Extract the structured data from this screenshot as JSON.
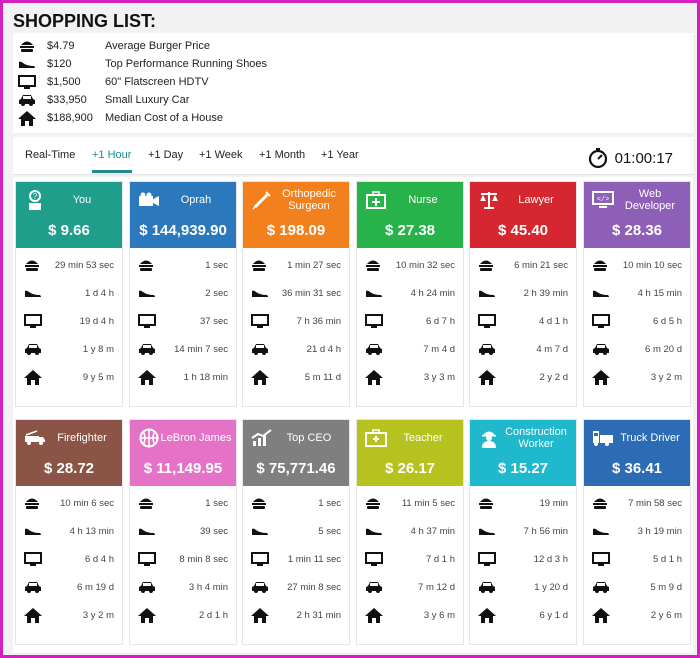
{
  "shopping": {
    "title": "SHOPPING LIST:",
    "items": [
      {
        "icon": "burger-icon",
        "price": "$4.79",
        "name": "Average Burger Price"
      },
      {
        "icon": "shoe-icon",
        "price": "$120",
        "name": "Top Performance Running Shoes"
      },
      {
        "icon": "tv-icon",
        "price": "$1,500",
        "name": "60\" Flatscreen HDTV"
      },
      {
        "icon": "car-icon",
        "price": "$33,950",
        "name": "Small Luxury Car"
      },
      {
        "icon": "house-icon",
        "price": "$188,900",
        "name": "Median Cost of a House"
      }
    ]
  },
  "tabs": [
    "Real-Time",
    "+1 Hour",
    "+1 Day",
    "+1 Week",
    "+1 Month",
    "+1 Year"
  ],
  "active_tab": "+1 Hour",
  "timer": "01:00:17",
  "cards": [
    {
      "name": "You",
      "value": "$ 9.66",
      "color": "#1f9e8c",
      "icon": "person-icon",
      "times": [
        "29 min 53 sec",
        "1 d 4 h",
        "19 d 4 h",
        "1 y 8 m",
        "9 y 5 m"
      ]
    },
    {
      "name": "Oprah",
      "value": "$ 144,939.90",
      "color": "#2b78bd",
      "icon": "camera-icon",
      "times": [
        "1 sec",
        "2 sec",
        "37 sec",
        "14 min 7 sec",
        "1 h 18 min"
      ]
    },
    {
      "name": "Orthopedic Surgeon",
      "value": "$ 198.09",
      "color": "#f2811d",
      "icon": "syringe-icon",
      "times": [
        "1 min 27 sec",
        "36 min 31 sec",
        "7 h 36 min",
        "21 d 4 h",
        "5 m 11 d"
      ]
    },
    {
      "name": "Nurse",
      "value": "$ 27.38",
      "color": "#27b24a",
      "icon": "medkit-icon",
      "times": [
        "10 min 32 sec",
        "4 h 24 min",
        "6 d 7 h",
        "7 m 4 d",
        "3 y 3 m"
      ]
    },
    {
      "name": "Lawyer",
      "value": "$ 45.40",
      "color": "#d6262f",
      "icon": "scales-icon",
      "times": [
        "6 min 21 sec",
        "2 h 39 min",
        "4 d 1 h",
        "4 m 7 d",
        "2 y 2 d"
      ]
    },
    {
      "name": "Web Developer",
      "value": "$ 28.36",
      "color": "#8e5fb7",
      "icon": "monitor-code-icon",
      "times": [
        "10 min 10 sec",
        "4 h 15 min",
        "6 d 5 h",
        "6 m 20 d",
        "3 y 2 m"
      ]
    },
    {
      "name": "Firefighter",
      "value": "$ 28.72",
      "color": "#8b5447",
      "icon": "firetruck-icon",
      "times": [
        "10 min 6 sec",
        "4 h 13 min",
        "6 d 4 h",
        "6 m 19 d",
        "3 y 2 m"
      ]
    },
    {
      "name": "LeBron James",
      "value": "$ 11,149.95",
      "color": "#e472c7",
      "icon": "basketball-icon",
      "times": [
        "1 sec",
        "39 sec",
        "8 min 8 sec",
        "3 h 4 min",
        "2 d 1 h"
      ]
    },
    {
      "name": "Top CEO",
      "value": "$ 75,771.46",
      "color": "#7f7f7f",
      "icon": "chart-up-icon",
      "times": [
        "1 sec",
        "5 sec",
        "1 min 11 sec",
        "27 min 8 sec",
        "2 h 31 min"
      ]
    },
    {
      "name": "Teacher",
      "value": "$ 26.17",
      "color": "#b5c21f",
      "icon": "briefcase-icon",
      "times": [
        "11 min 5 sec",
        "4 h 37 min",
        "7 d 1 h",
        "7 m 12 d",
        "3 y 6 m"
      ]
    },
    {
      "name": "Construction Worker",
      "value": "$ 15.27",
      "color": "#1fb8cc",
      "icon": "worker-icon",
      "times": [
        "19 min",
        "7 h 56 min",
        "12 d 3 h",
        "1 y 20 d",
        "6 y 1 d"
      ]
    },
    {
      "name": "Truck Driver",
      "value": "$ 36.41",
      "color": "#2c6cb4",
      "icon": "truck-icon",
      "times": [
        "7 min 58 sec",
        "3 h 19 min",
        "5 d 1 h",
        "5 m 9 d",
        "2 y 6 m"
      ]
    }
  ]
}
